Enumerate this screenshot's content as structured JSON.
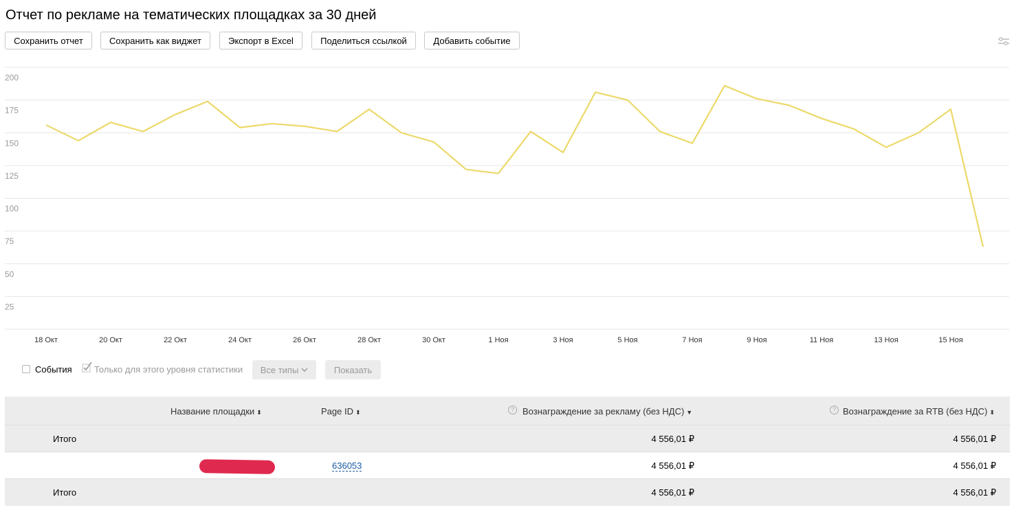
{
  "page": {
    "title": "Отчет по рекламе на тематических площадках за 30 дней"
  },
  "toolbar": {
    "buttons": [
      {
        "label": "Сохранить отчет"
      },
      {
        "label": "Сохранить как виджет"
      },
      {
        "label": "Экспорт в Excel"
      },
      {
        "label": "Поделиться ссылкой"
      },
      {
        "label": "Добавить событие"
      }
    ],
    "settings_icon": "sliders-icon"
  },
  "chart_data": {
    "type": "line",
    "color": "#ecd96a",
    "ylim": [
      0,
      200
    ],
    "y_ticks": [
      "200",
      "175",
      "150",
      "125",
      "100",
      "75",
      "50",
      "25"
    ],
    "x_tick_labels": [
      "18 Окт",
      "20 Окт",
      "22 Окт",
      "24 Окт",
      "26 Окт",
      "28 Окт",
      "30 Окт",
      "1 Ноя",
      "3 Ноя",
      "5 Ноя",
      "7 Ноя",
      "9 Ноя",
      "11 Ноя",
      "13 Ноя",
      "15 Ноя"
    ],
    "x": [
      "18 Окт",
      "19 Окт",
      "20 Окт",
      "21 Окт",
      "22 Окт",
      "23 Окт",
      "24 Окт",
      "25 Окт",
      "26 Окт",
      "27 Окт",
      "28 Окт",
      "29 Окт",
      "30 Окт",
      "31 Окт",
      "1 Ноя",
      "2 Ноя",
      "3 Ноя",
      "4 Ноя",
      "5 Ноя",
      "6 Ноя",
      "7 Ноя",
      "8 Ноя",
      "9 Ноя",
      "10 Ноя",
      "11 Ноя",
      "12 Ноя",
      "13 Ноя",
      "14 Ноя",
      "15 Ноя",
      "16 Ноя"
    ],
    "values": [
      156,
      144,
      158,
      151,
      164,
      174,
      154,
      157,
      155,
      151,
      168,
      150,
      143,
      122,
      119,
      151,
      135,
      181,
      175,
      151,
      142,
      186,
      176,
      171,
      161,
      153,
      139,
      150,
      168,
      63
    ],
    "grid": true
  },
  "filters": {
    "events_label": "События",
    "only_level_label": "Только для этого уровня статистики",
    "all_types_label": "Все типы",
    "show_label": "Показать"
  },
  "table": {
    "headers": {
      "name": "Название площадки",
      "page_id": "Page ID",
      "reward_ads": "Вознаграждение за рекламу (без НДС)",
      "reward_rtb": "Вознаграждение за RTB (без НДС)"
    },
    "total_label": "Итого",
    "total_ads": "4 556,01 ₽",
    "total_rtb": "4 556,01 ₽",
    "rows": [
      {
        "page_id": "636053",
        "reward_ads": "4 556,01 ₽",
        "reward_rtb": "4 556,01 ₽"
      }
    ],
    "footer_label": "Итого",
    "footer_ads": "4 556,01 ₽",
    "footer_rtb": "4 556,01 ₽"
  }
}
